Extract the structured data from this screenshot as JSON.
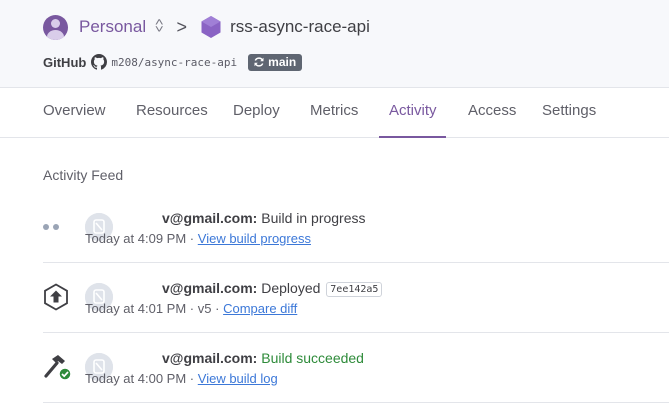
{
  "breadcrumb": {
    "account": "Personal",
    "separator": ">",
    "app_name": "rss-async-race-api"
  },
  "github": {
    "label": "GitHub",
    "repo": "m208/async-race-api",
    "branch": "main"
  },
  "tabs": [
    {
      "label": "Overview"
    },
    {
      "label": "Resources"
    },
    {
      "label": "Deploy"
    },
    {
      "label": "Metrics"
    },
    {
      "label": "Activity",
      "active": true
    },
    {
      "label": "Access"
    },
    {
      "label": "Settings"
    }
  ],
  "feed": {
    "title": "Activity Feed",
    "items": [
      {
        "icon": "in-progress-dots-icon",
        "user": "v@gmail.com:",
        "message": "Build in progress",
        "time": "Today at 4:09 PM",
        "sep": "·",
        "link": "View build progress"
      },
      {
        "icon": "deploy-arrow-icon",
        "user": "v@gmail.com:",
        "message": "Deployed",
        "commit": "7ee142a5",
        "time": "Today at 4:01 PM",
        "sep": "·",
        "version": "v5",
        "link": "Compare diff"
      },
      {
        "icon": "build-hammer-success-icon",
        "user": "v@gmail.com:",
        "message": "Build succeeded",
        "time": "Today at 4:00 PM",
        "sep": "·",
        "link": "View build log"
      }
    ]
  },
  "colors": {
    "accent": "#79589f",
    "link": "#3c78d8",
    "success": "#2e8b3a"
  }
}
